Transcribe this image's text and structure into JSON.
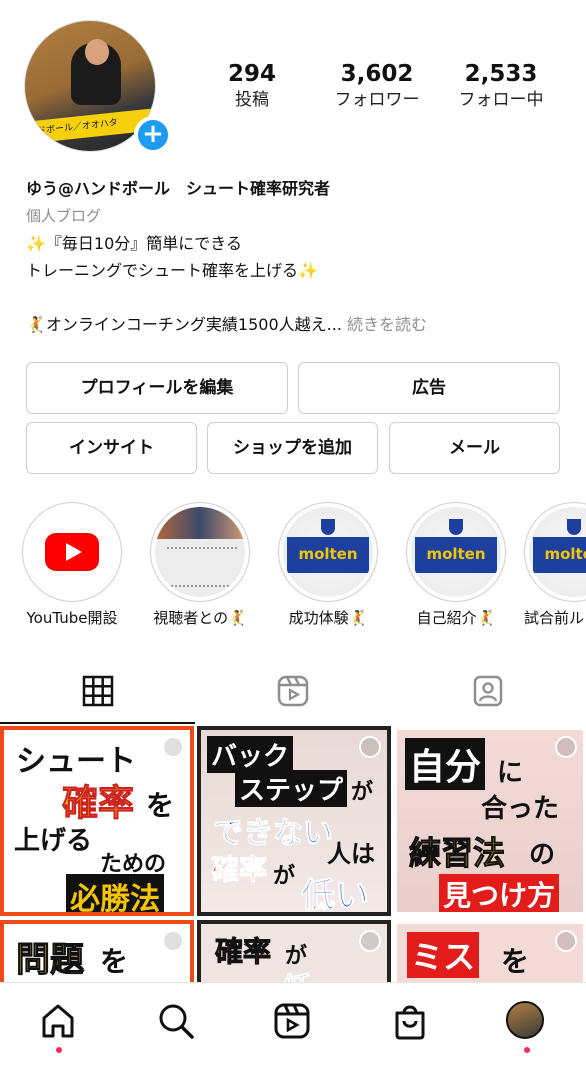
{
  "profile": {
    "avatar_banner_text": "ドボール／オオハタ",
    "add_badge": "+"
  },
  "stats": {
    "posts_count": "294",
    "posts_label": "投稿",
    "followers_count": "3,602",
    "followers_label": "フォロワー",
    "following_count": "2,533",
    "following_label": "フォロー中"
  },
  "bio": {
    "name": "ゆう@ハンドボール　シュート確率研究者",
    "category": "個人ブログ",
    "line1": "✨『毎日10分』簡単にできる",
    "line2": "トレーニングでシュート確率を上げる✨",
    "line3": "🤾オンラインコーチング実績1500人越え... ",
    "more": "続きを読む"
  },
  "buttons": {
    "edit_profile": "プロフィールを編集",
    "ad": "広告",
    "insight": "インサイト",
    "add_shop": "ショップを追加",
    "mail": "メール"
  },
  "highlights": [
    {
      "caption": "YouTube開設",
      "icon": "youtube-icon"
    },
    {
      "caption": "視聴者との🤾",
      "icon": "chat-screenshot"
    },
    {
      "caption": "成功体験🤾",
      "icon": "handball-ball"
    },
    {
      "caption": "自己紹介🤾",
      "icon": "handball-ball"
    },
    {
      "caption": "試合前ル",
      "icon": "handball-ball"
    }
  ],
  "ball_logo": "molten",
  "posts": [
    {
      "l1": "シュート",
      "l2": "確率",
      "l3": "を",
      "l4": "上げる",
      "l5": "ための",
      "l6": "必勝法"
    },
    {
      "l1": "バック",
      "l2": "ステップ",
      "l3": "が",
      "l4": "できない",
      "l5": "人は",
      "l6": "確率",
      "l7": "が",
      "l8": "低い"
    },
    {
      "l1": "自分",
      "l2": "に",
      "l3": "合った",
      "l4": "練習法",
      "l5": "の",
      "l6": "見つけ方"
    },
    {
      "l1": "問題",
      "l2": "を"
    },
    {
      "l1": "確率",
      "l2": "が",
      "l3": "低"
    },
    {
      "l1": "ミス",
      "l2": "を"
    }
  ],
  "colors": {
    "accent_blue": "#1d9bf0",
    "notification_dot": "#ff2b5a",
    "post_border_orange": "#ef4a1a"
  }
}
